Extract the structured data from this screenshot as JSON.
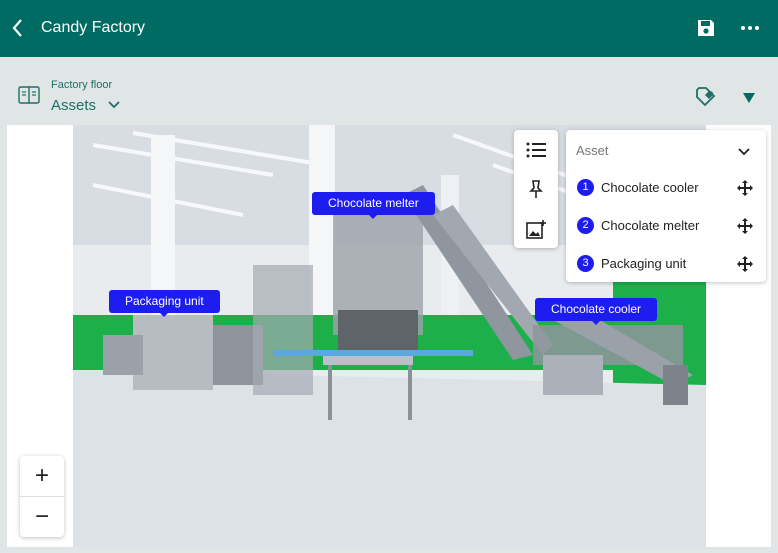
{
  "app": {
    "title": "Candy Factory"
  },
  "subheader": {
    "breadcrumb": "Factory floor",
    "title": "Assets"
  },
  "labels": [
    {
      "text": "Chocolate melter"
    },
    {
      "text": "Packaging unit"
    },
    {
      "text": "Chocolate cooler"
    }
  ],
  "asset_panel": {
    "header": "Asset",
    "items": [
      {
        "num": "1",
        "name": "Chocolate cooler"
      },
      {
        "num": "2",
        "name": "Chocolate melter"
      },
      {
        "num": "3",
        "name": "Packaging unit"
      }
    ]
  },
  "zoom": {
    "in": "+",
    "out": "−"
  },
  "colors": {
    "topbar": "#006b63",
    "accent": "#1d1df0",
    "floor_green": "#1db04a",
    "text_teal": "#1f6e68"
  },
  "icons": [
    "back-icon",
    "save-icon",
    "more-icon",
    "book-icon",
    "chevron-down-icon",
    "tag-icon",
    "triangle-down-icon",
    "list-icon",
    "pin-icon",
    "add-image-icon",
    "move-icon"
  ]
}
